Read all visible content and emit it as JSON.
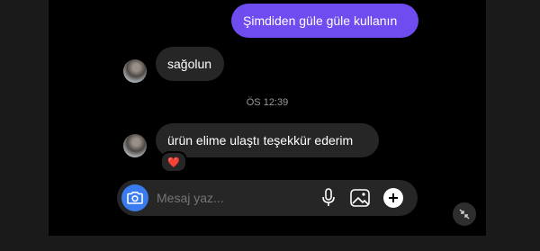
{
  "messages": [
    {
      "text": "Şimdiden güle güle kullanın",
      "direction": "outgoing"
    },
    {
      "text": "sağolun",
      "direction": "incoming"
    },
    {
      "text": "ürün elime ulaştı teşekkür ederim",
      "direction": "incoming",
      "reaction": "❤️"
    }
  ],
  "timestamp": "ÖS 12:39",
  "composer": {
    "placeholder": "Mesaj yaz...",
    "icons": [
      "camera-icon",
      "microphone-icon",
      "image-icon",
      "plus-icon"
    ]
  },
  "colors": {
    "outgoing_bubble": "#6f4cf0",
    "incoming_bubble": "#262626",
    "camera_button": "#3a7bef",
    "chat_background": "#000000"
  }
}
